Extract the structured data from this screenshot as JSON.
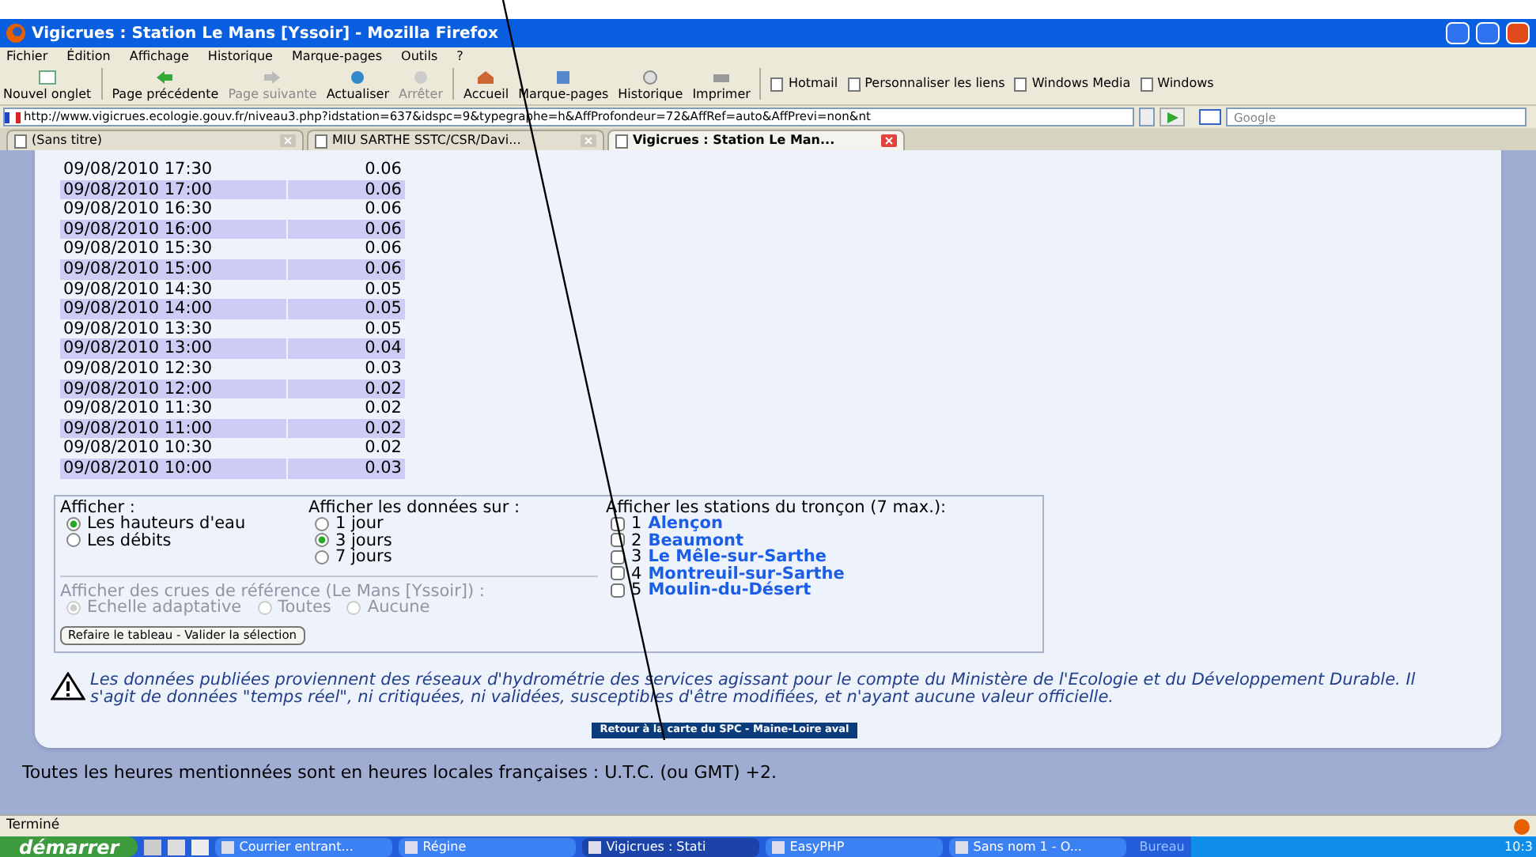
{
  "window": {
    "title": "Vigicrues : Station Le Mans [Yssoir] - Mozilla Firefox"
  },
  "menu": [
    "Fichier",
    "Édition",
    "Affichage",
    "Historique",
    "Marque-pages",
    "Outils",
    "?"
  ],
  "toolbar": [
    {
      "kind": "newtab",
      "label": "Nouvel onglet",
      "disabled": false
    },
    {
      "kind": "back",
      "label": "Page précédente",
      "disabled": false
    },
    {
      "kind": "forward",
      "label": "Page suivante",
      "disabled": true
    },
    {
      "kind": "reload",
      "label": "Actualiser",
      "disabled": false
    },
    {
      "kind": "stop",
      "label": "Arrêter",
      "disabled": true
    },
    {
      "kind": "home",
      "label": "Accueil",
      "disabled": false
    },
    {
      "kind": "bookmarks",
      "label": "Marque-pages",
      "disabled": false
    },
    {
      "kind": "history",
      "label": "Historique",
      "disabled": false
    },
    {
      "kind": "print",
      "label": "Imprimer",
      "disabled": false
    }
  ],
  "bookmarks": [
    "Hotmail",
    "Personnaliser les liens",
    "Windows Media",
    "Windows"
  ],
  "address": {
    "value": "http://www.vigicrues.ecologie.gouv.fr/niveau3.php?idstation=637&idspc=9&typegraphe=h&AffProfondeur=72&AffRef=auto&AffPrevi=non&nt",
    "search_placeholder": "Google"
  },
  "tabs": [
    {
      "label": "(Sans titre)",
      "selected": false
    },
    {
      "label": "MIU SARTHE SSTC/CSR/Davi...",
      "selected": false
    },
    {
      "label": "Vigicrues : Station Le Man...",
      "selected": true
    }
  ],
  "table": {
    "rows": [
      {
        "date": "09/08/2010 17:30",
        "value": "0.06"
      },
      {
        "date": "09/08/2010 17:00",
        "value": "0.06"
      },
      {
        "date": "09/08/2010 16:30",
        "value": "0.06"
      },
      {
        "date": "09/08/2010 16:00",
        "value": "0.06"
      },
      {
        "date": "09/08/2010 15:30",
        "value": "0.06"
      },
      {
        "date": "09/08/2010 15:00",
        "value": "0.06"
      },
      {
        "date": "09/08/2010 14:30",
        "value": "0.05"
      },
      {
        "date": "09/08/2010 14:00",
        "value": "0.05"
      },
      {
        "date": "09/08/2010 13:30",
        "value": "0.05"
      },
      {
        "date": "09/08/2010 13:00",
        "value": "0.04"
      },
      {
        "date": "09/08/2010 12:30",
        "value": "0.03"
      },
      {
        "date": "09/08/2010 12:00",
        "value": "0.02"
      },
      {
        "date": "09/08/2010 11:30",
        "value": "0.02"
      },
      {
        "date": "09/08/2010 11:00",
        "value": "0.02"
      },
      {
        "date": "09/08/2010 10:30",
        "value": "0.02"
      },
      {
        "date": "09/08/2010 10:00",
        "value": "0.03"
      }
    ]
  },
  "form": {
    "display": {
      "label": "Afficher :",
      "options": [
        {
          "label": "Les hauteurs d'eau",
          "selected": true
        },
        {
          "label": "Les débits",
          "selected": false
        }
      ]
    },
    "period": {
      "label": "Afficher les données sur :",
      "options": [
        {
          "label": "1 jour",
          "selected": false
        },
        {
          "label": "3 jours",
          "selected": true
        },
        {
          "label": "7 jours",
          "selected": false
        }
      ]
    },
    "reference": {
      "label": "Afficher des crues de référence (Le Mans [Yssoir]) :",
      "disabled": true,
      "options": [
        {
          "label": "Echelle adaptative",
          "selected": true
        },
        {
          "label": "Toutes",
          "selected": false
        },
        {
          "label": "Aucune",
          "selected": false
        }
      ]
    },
    "submit": "Refaire le tableau - Valider la sélection",
    "stations": {
      "label": "Afficher les stations du tronçon (7 max.):",
      "items": [
        {
          "number": "1",
          "name": "Alençon",
          "checked": false
        },
        {
          "number": "2",
          "name": "Beaumont",
          "checked": false
        },
        {
          "number": "3",
          "name": "Le Mêle-sur-Sarthe",
          "checked": false
        },
        {
          "number": "4",
          "name": "Montreuil-sur-Sarthe",
          "checked": false
        },
        {
          "number": "5",
          "name": "Moulin-du-Désert",
          "checked": false
        }
      ]
    }
  },
  "notice": "Les données publiées proviennent des réseaux d'hydrométrie des services agissant pour le compte du Ministère de l'Ecologie et du Développement Durable. Il s'agit de données \"temps réel\", ni critiquées, ni validées, susceptibles d'être modifiées, et n'ayant aucune valeur officielle.",
  "spc_button": "Retour à la carte du SPC - Maine-Loire aval",
  "footer_note": "Toutes les heures mentionnées sont en heures locales françaises : U.T.C. (ou GMT) +2.",
  "status_bar": "Terminé",
  "taskbar": {
    "start": "démarrer",
    "items": [
      {
        "label": "Courrier entrant...",
        "selected": false
      },
      {
        "label": "Régine",
        "selected": false
      },
      {
        "label": "Vigicrues : Stati",
        "selected": true
      },
      {
        "label": "EasyPHP",
        "selected": false
      },
      {
        "label": "Sans nom 1 - O...",
        "selected": false
      }
    ],
    "tray_label": "Bureau",
    "clock": "10:3"
  }
}
